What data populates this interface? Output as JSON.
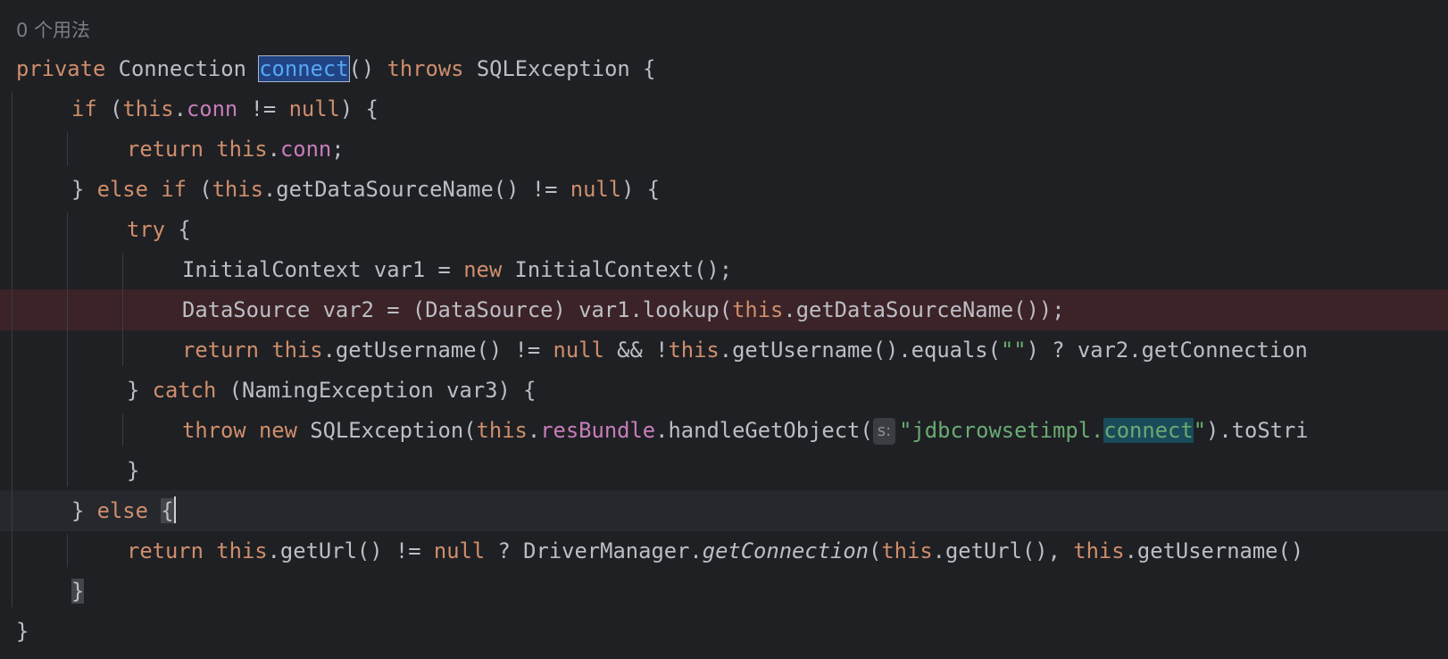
{
  "editor": {
    "usage_hint": "0 个用法",
    "param_hint": "s:",
    "colors": {
      "background": "#1f2023",
      "keyword": "#cf8e6d",
      "field": "#c77dbb",
      "string": "#6aab73",
      "method_declaration": "#56a8f5",
      "breakpoint_line": "#3b2327"
    },
    "lines": [
      {
        "indent": 0,
        "tokens": [
          {
            "t": "private ",
            "c": "kw"
          },
          {
            "t": "Connection "
          },
          {
            "t": "connect",
            "c": "hl-decl"
          },
          {
            "t": "() "
          },
          {
            "t": "throws ",
            "c": "kw"
          },
          {
            "t": "SQLException {"
          }
        ]
      },
      {
        "indent": 1,
        "tokens": [
          {
            "t": "if ",
            "c": "kw"
          },
          {
            "t": "("
          },
          {
            "t": "this",
            "c": "kw"
          },
          {
            "t": "."
          },
          {
            "t": "conn",
            "c": "fld"
          },
          {
            "t": " != "
          },
          {
            "t": "null",
            "c": "kw"
          },
          {
            "t": ") {"
          }
        ]
      },
      {
        "indent": 2,
        "tokens": [
          {
            "t": "return ",
            "c": "kw"
          },
          {
            "t": "this",
            "c": "kw"
          },
          {
            "t": "."
          },
          {
            "t": "conn",
            "c": "fld"
          },
          {
            "t": ";"
          }
        ]
      },
      {
        "indent": 1,
        "tokens": [
          {
            "t": "} "
          },
          {
            "t": "else if ",
            "c": "kw"
          },
          {
            "t": "("
          },
          {
            "t": "this",
            "c": "kw"
          },
          {
            "t": ".getDataSourceName() != "
          },
          {
            "t": "null",
            "c": "kw"
          },
          {
            "t": ") {"
          }
        ]
      },
      {
        "indent": 2,
        "tokens": [
          {
            "t": "try ",
            "c": "kw"
          },
          {
            "t": "{"
          }
        ]
      },
      {
        "indent": 3,
        "tokens": [
          {
            "t": "InitialContext var1 = "
          },
          {
            "t": "new ",
            "c": "kw"
          },
          {
            "t": "InitialContext();"
          }
        ]
      },
      {
        "indent": 3,
        "breakpoint": true,
        "tokens": [
          {
            "t": "DataSource var2 = (DataSource) var1.lookup("
          },
          {
            "t": "this",
            "c": "kw"
          },
          {
            "t": ".getDataSourceName());"
          }
        ]
      },
      {
        "indent": 3,
        "tokens": [
          {
            "t": "return ",
            "c": "kw"
          },
          {
            "t": "this",
            "c": "kw"
          },
          {
            "t": ".getUsername() != "
          },
          {
            "t": "null",
            "c": "kw"
          },
          {
            "t": " && !"
          },
          {
            "t": "this",
            "c": "kw"
          },
          {
            "t": ".getUsername().equals("
          },
          {
            "t": "\"\"",
            "c": "str"
          },
          {
            "t": ") ? var2.getConnection"
          }
        ]
      },
      {
        "indent": 2,
        "tokens": [
          {
            "t": "} "
          },
          {
            "t": "catch ",
            "c": "kw"
          },
          {
            "t": "(NamingException var3) {"
          }
        ]
      },
      {
        "indent": 3,
        "tokens": [
          {
            "t": "throw ",
            "c": "kw"
          },
          {
            "t": "new ",
            "c": "kw"
          },
          {
            "t": "SQLException("
          },
          {
            "t": "this",
            "c": "kw"
          },
          {
            "t": "."
          },
          {
            "t": "resBundle",
            "c": "fld"
          },
          {
            "t": ".handleGetObject("
          },
          {
            "hint": true
          },
          {
            "t": "\"jdbcrowsetimpl.",
            "c": "str"
          },
          {
            "t": "connect",
            "c": "str hl-ref"
          },
          {
            "t": "\"",
            "c": "str"
          },
          {
            "t": ").toStri"
          }
        ]
      },
      {
        "indent": 2,
        "tokens": [
          {
            "t": "}"
          }
        ]
      },
      {
        "indent": 1,
        "caret": true,
        "tokens": [
          {
            "t": "} "
          },
          {
            "t": "else ",
            "c": "kw"
          },
          {
            "t": "{",
            "c": "brace-match",
            "caret": true
          }
        ]
      },
      {
        "indent": 2,
        "tokens": [
          {
            "t": "return ",
            "c": "kw"
          },
          {
            "t": "this",
            "c": "kw"
          },
          {
            "t": ".getUrl() != "
          },
          {
            "t": "null",
            "c": "kw"
          },
          {
            "t": " ? DriverManager."
          },
          {
            "t": "getConnection",
            "c": "it"
          },
          {
            "t": "("
          },
          {
            "t": "this",
            "c": "kw"
          },
          {
            "t": ".getUrl(), "
          },
          {
            "t": "this",
            "c": "kw"
          },
          {
            "t": ".getUsername()"
          }
        ]
      },
      {
        "indent": 1,
        "tokens": [
          {
            "t": "}",
            "c": "brace-match"
          }
        ]
      },
      {
        "indent": 0,
        "tokens": [
          {
            "t": "}"
          }
        ]
      }
    ]
  }
}
